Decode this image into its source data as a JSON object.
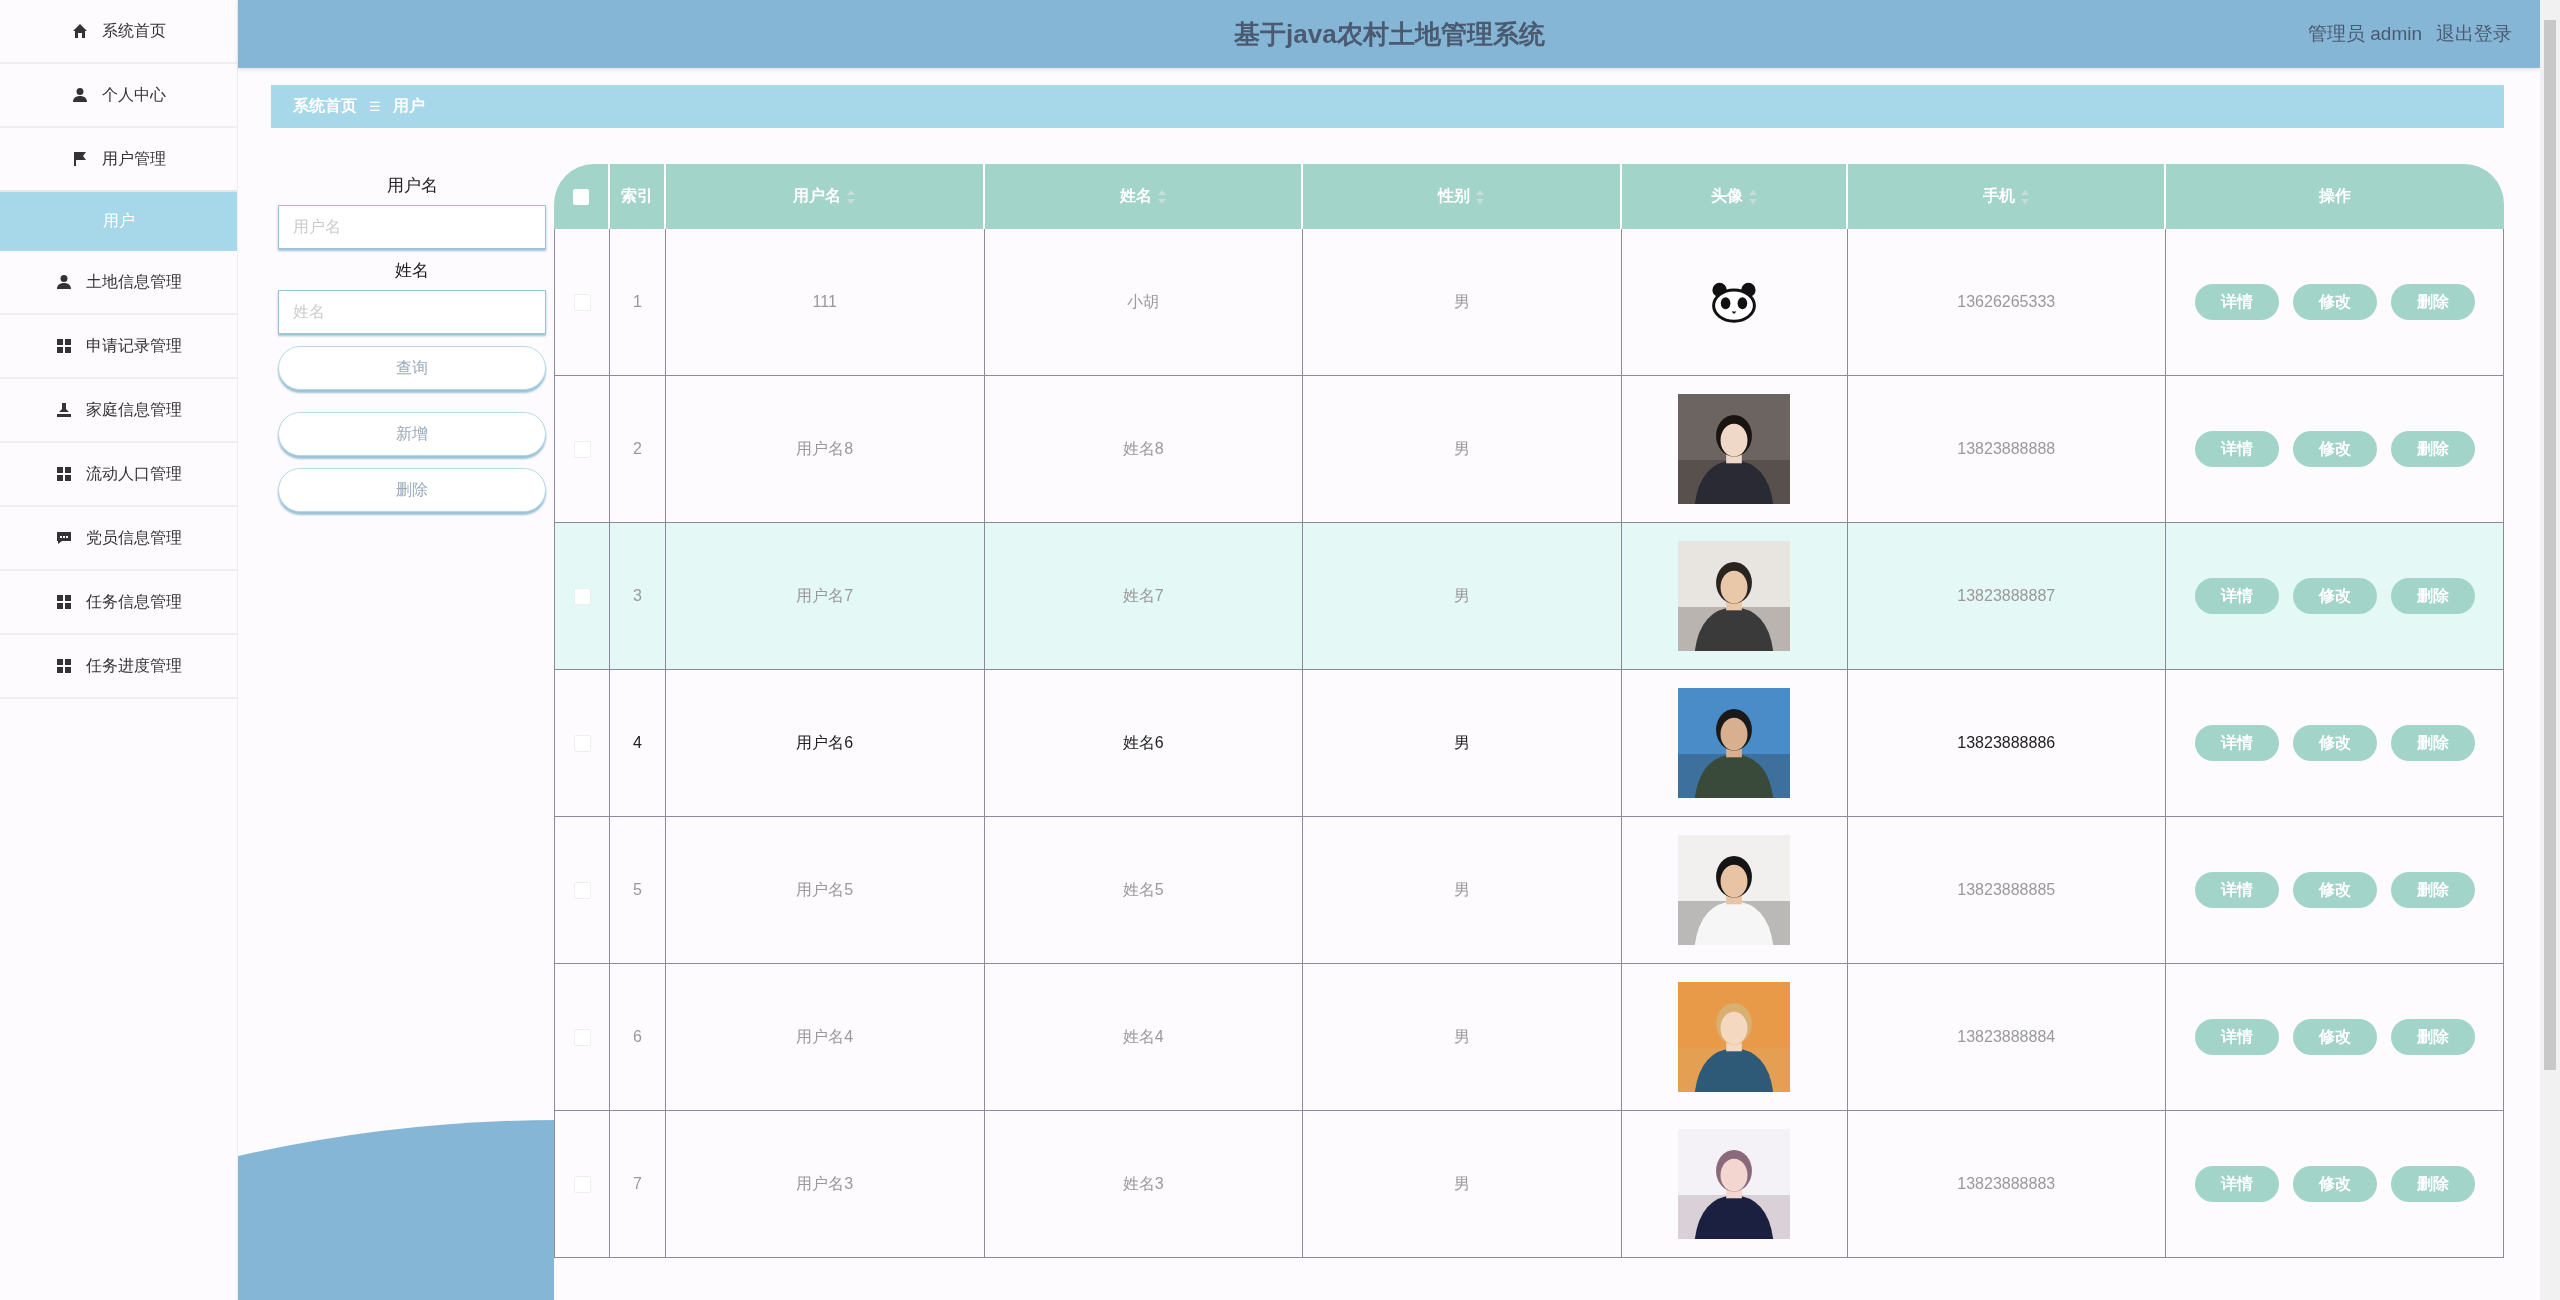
{
  "header": {
    "title": "基于java农村土地管理系统",
    "user": "管理员 admin",
    "logout": "退出登录"
  },
  "menu": [
    {
      "label": "系统首页",
      "selected": false
    },
    {
      "label": "个人中心",
      "selected": false
    },
    {
      "label": "用户管理",
      "selected": false,
      "expanded": true,
      "children": [
        {
          "label": "用户",
          "selected": true
        }
      ]
    },
    {
      "label": "土地信息管理",
      "selected": false
    },
    {
      "label": "申请记录管理",
      "selected": false
    },
    {
      "label": "家庭信息管理",
      "selected": false
    },
    {
      "label": "流动人口管理",
      "selected": false
    },
    {
      "label": "党员信息管理",
      "selected": false
    },
    {
      "label": "任务信息管理",
      "selected": false
    },
    {
      "label": "任务进度管理",
      "selected": false
    }
  ],
  "breadcrumb": {
    "items": [
      "系统首页",
      "用户"
    ],
    "separator": "☰"
  },
  "search": {
    "fields": [
      {
        "label": "用户名",
        "placeholder": "用户名"
      },
      {
        "label": "姓名",
        "placeholder": "姓名"
      }
    ],
    "query_button": "查询",
    "buttons": [
      "新增",
      "删除"
    ]
  },
  "table": {
    "select_all": false,
    "columns": [
      {
        "label": "索引",
        "sortable": false
      },
      {
        "label": "用户名",
        "sortable": true
      },
      {
        "label": "姓名",
        "sortable": true
      },
      {
        "label": "性别",
        "sortable": true
      },
      {
        "label": "头像",
        "sortable": true
      },
      {
        "label": "手机",
        "sortable": true
      },
      {
        "label": "操作",
        "sortable": false
      }
    ],
    "rows": [
      {
        "checked": false,
        "hovered": false,
        "selected": false,
        "index": "1",
        "username": "111",
        "name": "小胡",
        "gender": "男",
        "avatar": {
          "kind": "panda"
        },
        "phone": "13626265333",
        "actions": [
          "详情",
          "修改",
          "删除"
        ]
      },
      {
        "checked": false,
        "hovered": false,
        "selected": false,
        "index": "2",
        "username": "用户名8",
        "name": "姓名8",
        "gender": "男",
        "phone": "13823888888",
        "actions": [
          "详情",
          "修改",
          "删除"
        ]
      },
      {
        "checked": false,
        "hovered": true,
        "selected": false,
        "index": "3",
        "username": "用户名7",
        "name": "姓名7",
        "gender": "男",
        "phone": "13823888887",
        "actions": [
          "详情",
          "修改",
          "删除"
        ]
      },
      {
        "checked": false,
        "hovered": false,
        "selected": true,
        "index": "4",
        "username": "用户名6",
        "name": "姓名6",
        "gender": "男",
        "phone": "13823888886",
        "actions": [
          "详情",
          "修改",
          "删除"
        ]
      },
      {
        "checked": false,
        "hovered": false,
        "selected": false,
        "index": "5",
        "username": "用户名5",
        "name": "姓名5",
        "gender": "男",
        "phone": "13823888885",
        "actions": [
          "详情",
          "修改",
          "删除"
        ]
      },
      {
        "checked": false,
        "hovered": false,
        "selected": false,
        "index": "6",
        "username": "用户名4",
        "name": "姓名4",
        "gender": "男",
        "phone": "13823888884",
        "actions": [
          "详情",
          "修改",
          "删除"
        ]
      },
      {
        "checked": false,
        "hovered": false,
        "selected": false,
        "index": "7",
        "username": "用户名3",
        "name": "姓名3",
        "gender": "男",
        "phone": "13823888883",
        "actions": [
          "详情",
          "修改",
          "删除"
        ]
      }
    ]
  }
}
